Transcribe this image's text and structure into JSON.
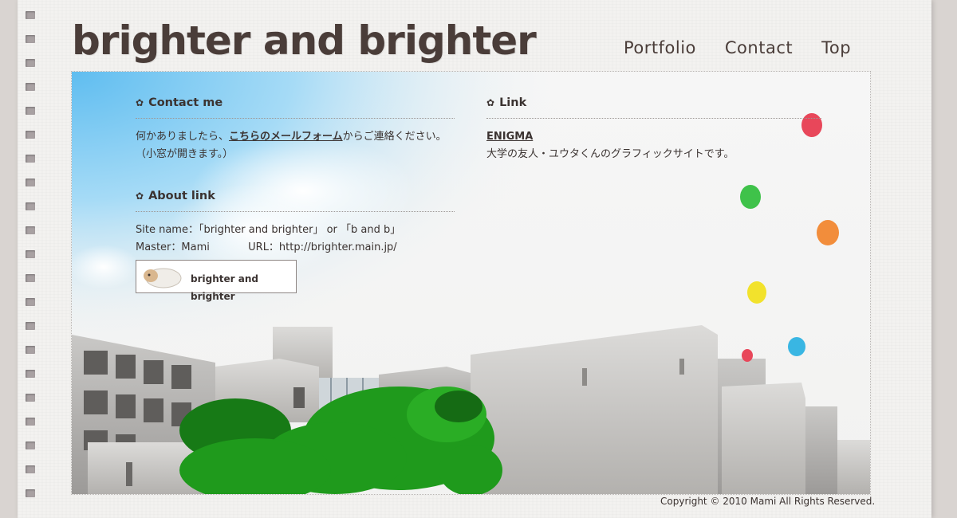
{
  "site": {
    "logo_text": "brighter and brighter"
  },
  "nav": {
    "items": [
      "Portfolio",
      "Contact",
      "Top"
    ]
  },
  "contact": {
    "title": "Contact me",
    "text_before": "何かありましたら、",
    "link_text": "こちらのメールフォーム",
    "text_after": "からご連絡ください。",
    "note": "（小窓が開きます。）"
  },
  "about": {
    "title": "About link",
    "site_name_line": "Site name：「brighter and brighter」 or 「b and b」",
    "master_line": "Master：Mami",
    "url_line": "URL：http://brighter.main.jp/",
    "banner_text": "brighter and brighter"
  },
  "links": {
    "title": "Link",
    "items": [
      {
        "name": "ENIGMA",
        "desc": "大学の友人・ユウタくんのグラフィックサイトです。"
      }
    ]
  },
  "footer": {
    "copyright": "Copyright © 2010 Mami All Rights Reserved."
  },
  "colors": {
    "text": "#3b3331",
    "sky": "#8fd0f5",
    "balloon_red": "#e8475a",
    "balloon_green": "#3fc24a",
    "balloon_orange": "#f28d3b",
    "balloon_yellow": "#f2e22c",
    "balloon_blue": "#39b6e3",
    "tree": "#1f9a1c"
  }
}
